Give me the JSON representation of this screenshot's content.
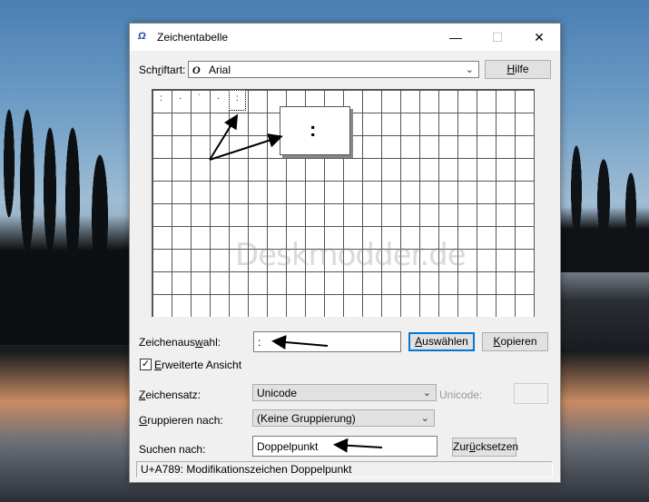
{
  "window": {
    "title": "Zeichentabelle",
    "minimize": "—",
    "maximize": "☐",
    "close": "✕"
  },
  "font_row": {
    "label_pre": "Sch",
    "label_ul": "r",
    "label_post": "iftart:",
    "font_icon": "O",
    "value": "Arial",
    "help_button_pre": "",
    "help_button_ul": "H",
    "help_button_post": "ilfe"
  },
  "grid": {
    "glyphs": [
      ":",
      "·",
      "˙",
      "·",
      ":"
    ],
    "magnified_glyph": ":",
    "watermark": "Deskmodder.de"
  },
  "selection_row": {
    "label_pre": "Zeichenaus",
    "label_ul": "w",
    "label_post": "ahl:",
    "value": ":",
    "select_button_pre": "",
    "select_button_ul": "A",
    "select_button_post": "uswählen",
    "copy_button_pre": "",
    "copy_button_ul": "K",
    "copy_button_post": "opieren"
  },
  "advanced": {
    "checked": "✓",
    "label_pre": "",
    "label_ul": "E",
    "label_post": "rweiterte Ansicht"
  },
  "charset_row": {
    "label_pre": "",
    "label_ul": "Z",
    "label_post": "eichensatz:",
    "value": "Unicode",
    "unicode_label": "Unicode:"
  },
  "group_row": {
    "label_pre": "",
    "label_ul": "G",
    "label_post": "ruppieren nach:",
    "value": "(Keine Gruppierung)"
  },
  "search_row": {
    "label_pre": "Suchen nach",
    "label_ul": "",
    "label_post": ":",
    "value": "Doppelpunkt",
    "reset_button_pre": "Zur",
    "reset_button_ul": "ü",
    "reset_button_post": "cksetzen"
  },
  "status": {
    "text": "U+A789: Modifikationszeichen Doppelpunkt"
  }
}
